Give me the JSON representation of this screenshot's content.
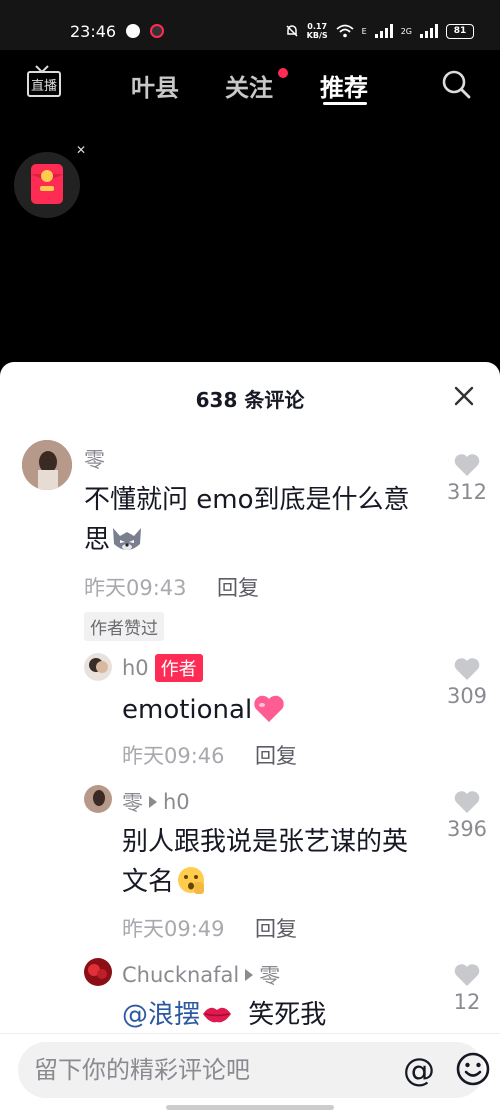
{
  "status_bar": {
    "time": "23:46",
    "speed_value": "0.17",
    "speed_unit": "KB/S",
    "battery": "81",
    "signal_1_label": "E",
    "signal_2_label": "2G"
  },
  "nav": {
    "live_label": "直播",
    "tabs": [
      "叶县",
      "关注",
      "推荐"
    ],
    "active_tab": "推荐"
  },
  "comments_sheet": {
    "title": "638 条评论",
    "comments": [
      {
        "user": "零",
        "text": "不懂就问 emo到底是什么意思",
        "emoji": "wolf-emoji-icon",
        "time": "昨天09:43",
        "reply_label": "回复",
        "likes": "312",
        "tag": "作者赞过"
      },
      {
        "user": "h0",
        "badge": "作者",
        "text": "emotional",
        "emoji": "heart-emoji-icon",
        "time": "昨天09:46",
        "reply_label": "回复",
        "likes": "309"
      },
      {
        "user": "零",
        "reply_to": "h0",
        "text_line1": "别人跟我说是张艺谋的英",
        "text_line2": "文名",
        "emoji": "shush-face-emoji-icon",
        "time": "昨天09:49",
        "reply_label": "回复",
        "likes": "396"
      },
      {
        "user": "Chucknafal",
        "reply_to": "零",
        "mention": "@浪摆",
        "emoji": "lips-emoji-icon",
        "text": "笑死我",
        "likes": "12"
      }
    ]
  },
  "bottom_bar": {
    "placeholder": "留下你的精彩评论吧",
    "at_label": "@"
  },
  "colors": {
    "accent": "#fe2c55",
    "mention": "#2c5aa0",
    "sheet_bg": "#ffffff",
    "page_bg": "#000000"
  }
}
